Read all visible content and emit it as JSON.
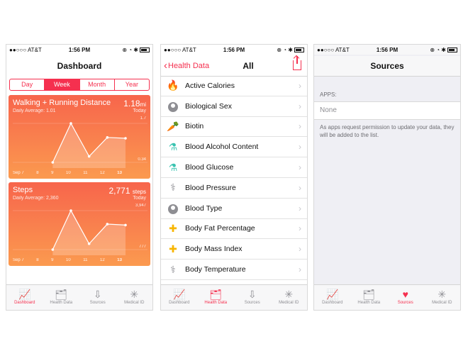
{
  "status": {
    "carrier": "●●○○○ AT&T",
    "time": "1:56 PM",
    "icons": "⊕ ◔ ✱"
  },
  "dashboard": {
    "title": "Dashboard",
    "segments": [
      "Day",
      "Week",
      "Month",
      "Year"
    ],
    "active_segment": "Week",
    "cards": [
      {
        "title": "Walking + Running Distance",
        "value": "1.18",
        "unit": "mi",
        "average": "Daily Average: 1.01",
        "today": "Today",
        "max_label": "1.7",
        "min_label": "0.34",
        "days": [
          "Sep 7",
          "8",
          "9",
          "10",
          "11",
          "12",
          "13"
        ],
        "values": [
          null,
          null,
          0.34,
          1.7,
          0.55,
          1.21,
          1.18
        ]
      },
      {
        "title": "Steps",
        "value": "2,771",
        "unit": "steps",
        "average": "Daily Average: 2,360",
        "today": "Today",
        "max_label": "3,947",
        "min_label": "777",
        "days": [
          "Sep 7",
          "8",
          "9",
          "10",
          "11",
          "12",
          "13"
        ],
        "values": [
          null,
          null,
          777,
          3947,
          1250,
          2850,
          2771
        ]
      }
    ]
  },
  "healthdata": {
    "back_label": "Health Data",
    "title": "All",
    "items": [
      {
        "label": "Active Calories",
        "icon": "flame-icon",
        "glyph": "🔥",
        "color": "#f5304f"
      },
      {
        "label": "Biological Sex",
        "icon": "person-icon",
        "glyph": "",
        "color": "#8e8e93"
      },
      {
        "label": "Biotin",
        "icon": "carrot-icon",
        "glyph": "🥕",
        "color": "#ff8c1a"
      },
      {
        "label": "Blood Alcohol Content",
        "icon": "flask-icon",
        "glyph": "⚗",
        "color": "#39c3b0"
      },
      {
        "label": "Blood Glucose",
        "icon": "flask-icon",
        "glyph": "⚗",
        "color": "#39c3b0"
      },
      {
        "label": "Blood Pressure",
        "icon": "stethoscope-icon",
        "glyph": "⚕",
        "color": "#8e8e93"
      },
      {
        "label": "Blood Type",
        "icon": "person-icon",
        "glyph": "",
        "color": "#8e8e93"
      },
      {
        "label": "Body Fat Percentage",
        "icon": "body-icon",
        "glyph": "✚",
        "color": "#f7b500"
      },
      {
        "label": "Body Mass Index",
        "icon": "body-icon",
        "glyph": "✚",
        "color": "#f7b500"
      },
      {
        "label": "Body Temperature",
        "icon": "stethoscope-icon",
        "glyph": "⚕",
        "color": "#8e8e93"
      }
    ]
  },
  "sources": {
    "title": "Sources",
    "section_header": "APPS:",
    "none_label": "None",
    "footer": "As apps request permission to update your data, they will be added to the list."
  },
  "tabs": [
    {
      "label": "Dashboard",
      "icon": "chart-icon",
      "glyph": "📈"
    },
    {
      "label": "Health Data",
      "icon": "folder-heart-icon",
      "glyph": "🗂"
    },
    {
      "label": "Sources",
      "icon": "download-icon",
      "glyph": "⇩"
    },
    {
      "label": "Medical ID",
      "icon": "asterisk-icon",
      "glyph": "✳"
    }
  ],
  "colors": {
    "accent": "#f5304f",
    "card_top": "#f7654c",
    "card_bottom": "#fb9a4f"
  }
}
